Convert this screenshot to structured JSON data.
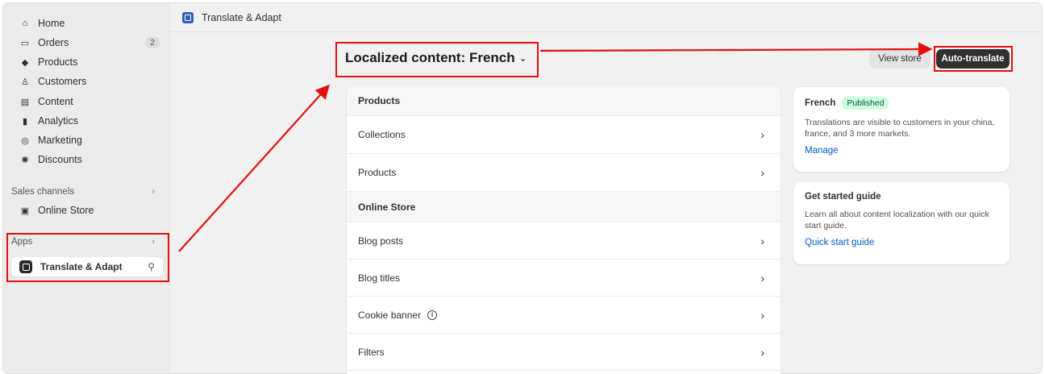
{
  "sidebar": {
    "items": [
      {
        "label": "Home",
        "icon": "home-icon",
        "glyph": "⌂"
      },
      {
        "label": "Orders",
        "icon": "orders-icon",
        "glyph": "▭",
        "badge": "2"
      },
      {
        "label": "Products",
        "icon": "tag-icon",
        "glyph": "◆"
      },
      {
        "label": "Customers",
        "icon": "person-icon",
        "glyph": "♙"
      },
      {
        "label": "Content",
        "icon": "content-icon",
        "glyph": "▤"
      },
      {
        "label": "Analytics",
        "icon": "bar-chart-icon",
        "glyph": "▮"
      },
      {
        "label": "Marketing",
        "icon": "target-icon",
        "glyph": "◎"
      },
      {
        "label": "Discounts",
        "icon": "discount-icon",
        "glyph": "✺"
      }
    ],
    "sales_channels_label": "Sales channels",
    "online_store_label": "Online Store",
    "apps_label": "Apps",
    "active_app_label": "Translate & Adapt"
  },
  "topbar": {
    "title": "Translate & Adapt"
  },
  "page": {
    "title": "Localized content: French",
    "view_store": "View store",
    "auto_translate": "Auto-translate"
  },
  "list": {
    "sections": [
      {
        "header": "Products",
        "rows": [
          "Collections",
          "Products"
        ]
      },
      {
        "header": "Online Store",
        "rows": [
          "Blog posts",
          "Blog titles",
          "Cookie banner",
          "Filters"
        ]
      }
    ]
  },
  "status_card": {
    "language": "French",
    "status": "Published",
    "text": "Translations are visible to customers in your china, france, and 3 more markets.",
    "link": "Manage"
  },
  "guide_card": {
    "title": "Get started guide",
    "text": "Learn all about content localization with our quick start guide.",
    "link": "Quick start guide"
  },
  "colors": {
    "accent_red": "#e01010",
    "link_blue": "#005bd3",
    "published_green": "#cdfee1"
  }
}
